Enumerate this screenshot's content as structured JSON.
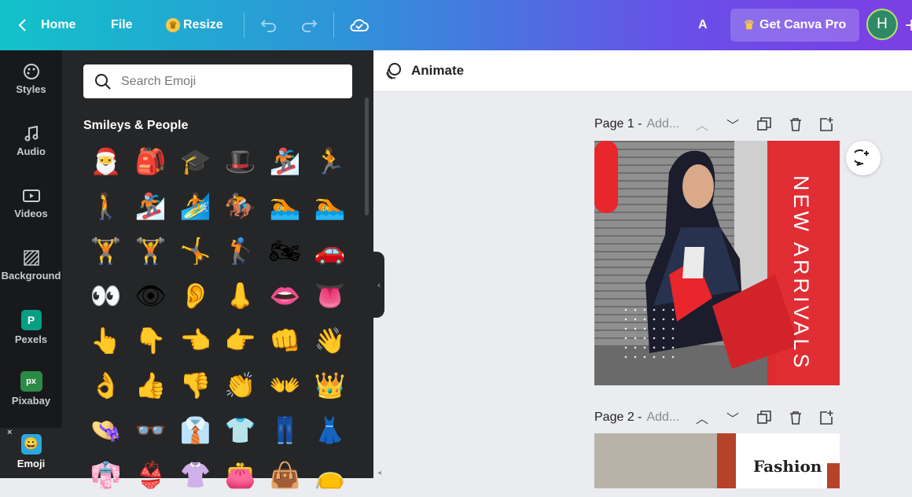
{
  "topbar": {
    "home_label": "Home",
    "file_label": "File",
    "resize_label": "Resize",
    "text_a": "A",
    "pro_label": "Get Canva Pro",
    "avatar_initial": "H"
  },
  "rail": {
    "items": [
      {
        "label": "Styles",
        "icon": "styles-icon"
      },
      {
        "label": "Audio",
        "icon": "music-note-icon"
      },
      {
        "label": "Videos",
        "icon": "video-icon"
      },
      {
        "label": "Background",
        "icon": "background-icon"
      },
      {
        "label": "Pexels",
        "icon": "pexels-icon"
      },
      {
        "label": "Pixabay",
        "icon": "pixabay-icon"
      },
      {
        "label": "Emoji",
        "icon": "emoji-icon",
        "active": true
      }
    ]
  },
  "panel": {
    "search_placeholder": "Search Emoji",
    "section_title": "Smileys & People",
    "emojis": [
      "🎅",
      "🎒",
      "🎓",
      "🎩",
      "🏂",
      "🏃",
      "🚶",
      "🏂",
      "🏄",
      "🏇",
      "🏊",
      "🏊",
      "🏋",
      "🏋",
      "🤸",
      "🏌",
      "🏍",
      "🚗",
      "👀",
      "👁",
      "👂",
      "👃",
      "👄",
      "👅",
      "👆",
      "👇",
      "👈",
      "👉",
      "👊",
      "👋",
      "👌",
      "👍",
      "👎",
      "👏",
      "👐",
      "👑",
      "👒",
      "👓",
      "👔",
      "👕",
      "👖",
      "👗",
      "👘",
      "👙",
      "👚",
      "👛",
      "👜",
      "👝"
    ]
  },
  "editor": {
    "animate_label": "Animate",
    "page1": {
      "title": "Page 1 -",
      "placeholder": "Add..."
    },
    "page2": {
      "title": "Page 2 -",
      "placeholder": "Add..."
    },
    "page1_text": "NEW ARRIVALS",
    "page2_text": "Fashion"
  },
  "colors": {
    "accent_red": "#e8262c",
    "panel_bg": "#252627",
    "rail_bg": "#18191b"
  }
}
